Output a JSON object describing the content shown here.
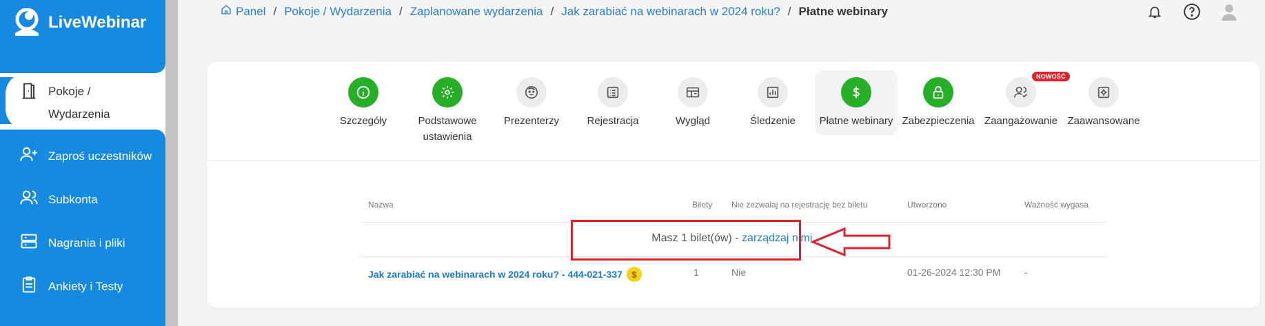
{
  "brand": {
    "name": "LiveWebinar"
  },
  "sidebar": {
    "items": [
      {
        "label": "Pokoje /",
        "label2": "Wydarzenia",
        "icon": "door-icon",
        "active": true
      },
      {
        "label": "Zaproś uczestników",
        "icon": "add-user-icon"
      },
      {
        "label": "Subkonta",
        "icon": "users-icon"
      },
      {
        "label": "Nagrania i pliki",
        "icon": "storage-icon"
      },
      {
        "label": "Ankiety i Testy",
        "icon": "clipboard-icon"
      }
    ]
  },
  "breadcrumb": {
    "items": [
      "Panel",
      "Pokoje / Wydarzenia",
      "Zaplanowane wydarzenia",
      "Jak zarabiać na webinarach w 2024 roku?"
    ],
    "current": "Płatne webinary",
    "separator": "/"
  },
  "top_icons": [
    "bell-icon",
    "help-icon",
    "avatar-icon"
  ],
  "tabs": [
    {
      "label": "Szczegóły",
      "icon": "info-icon",
      "style": "green"
    },
    {
      "label": "Podstawowe",
      "label2": "ustawienia",
      "icon": "gear-icon",
      "style": "green"
    },
    {
      "label": "Prezenterzy",
      "icon": "presenter-icon",
      "style": "gray"
    },
    {
      "label": "Rejestracja",
      "icon": "form-icon",
      "style": "gray"
    },
    {
      "label": "Wygląd",
      "icon": "layout-icon",
      "style": "gray"
    },
    {
      "label": "Śledzenie",
      "icon": "chart-icon",
      "style": "gray"
    },
    {
      "label": "Płatne webinary",
      "icon": "dollar-icon",
      "style": "green",
      "active": true
    },
    {
      "label": "Zabezpieczenia",
      "icon": "lock-icon",
      "style": "green"
    },
    {
      "label": "Zaangażowanie",
      "icon": "engagement-icon",
      "style": "gray",
      "badge": "NOWOŚĆ"
    },
    {
      "label": "Zaawansowane",
      "icon": "advanced-gear-icon",
      "style": "gray"
    }
  ],
  "table": {
    "headers": [
      "Nazwa",
      "Bilety",
      "Nie zezwalaj na rejestrację bez biletu",
      "Utworzono",
      "Ważność wygasa"
    ],
    "info": {
      "text": "Masz 1 bilet(ów) - ",
      "link": "zarządzaj nimi",
      "suffix": "."
    },
    "rows": [
      {
        "name": "Jak zarabiać na webinarach w 2024 roku? - 444-021-337",
        "tickets": "1",
        "no_reg": "Nie",
        "created": "01-26-2024 12:30 PM",
        "expires": "-"
      }
    ]
  },
  "coin_symbol": "$",
  "colors": {
    "sidebar": "#1689e0",
    "green": "#27b027",
    "link": "#2a7dc9",
    "highlight": "#e0202a"
  }
}
